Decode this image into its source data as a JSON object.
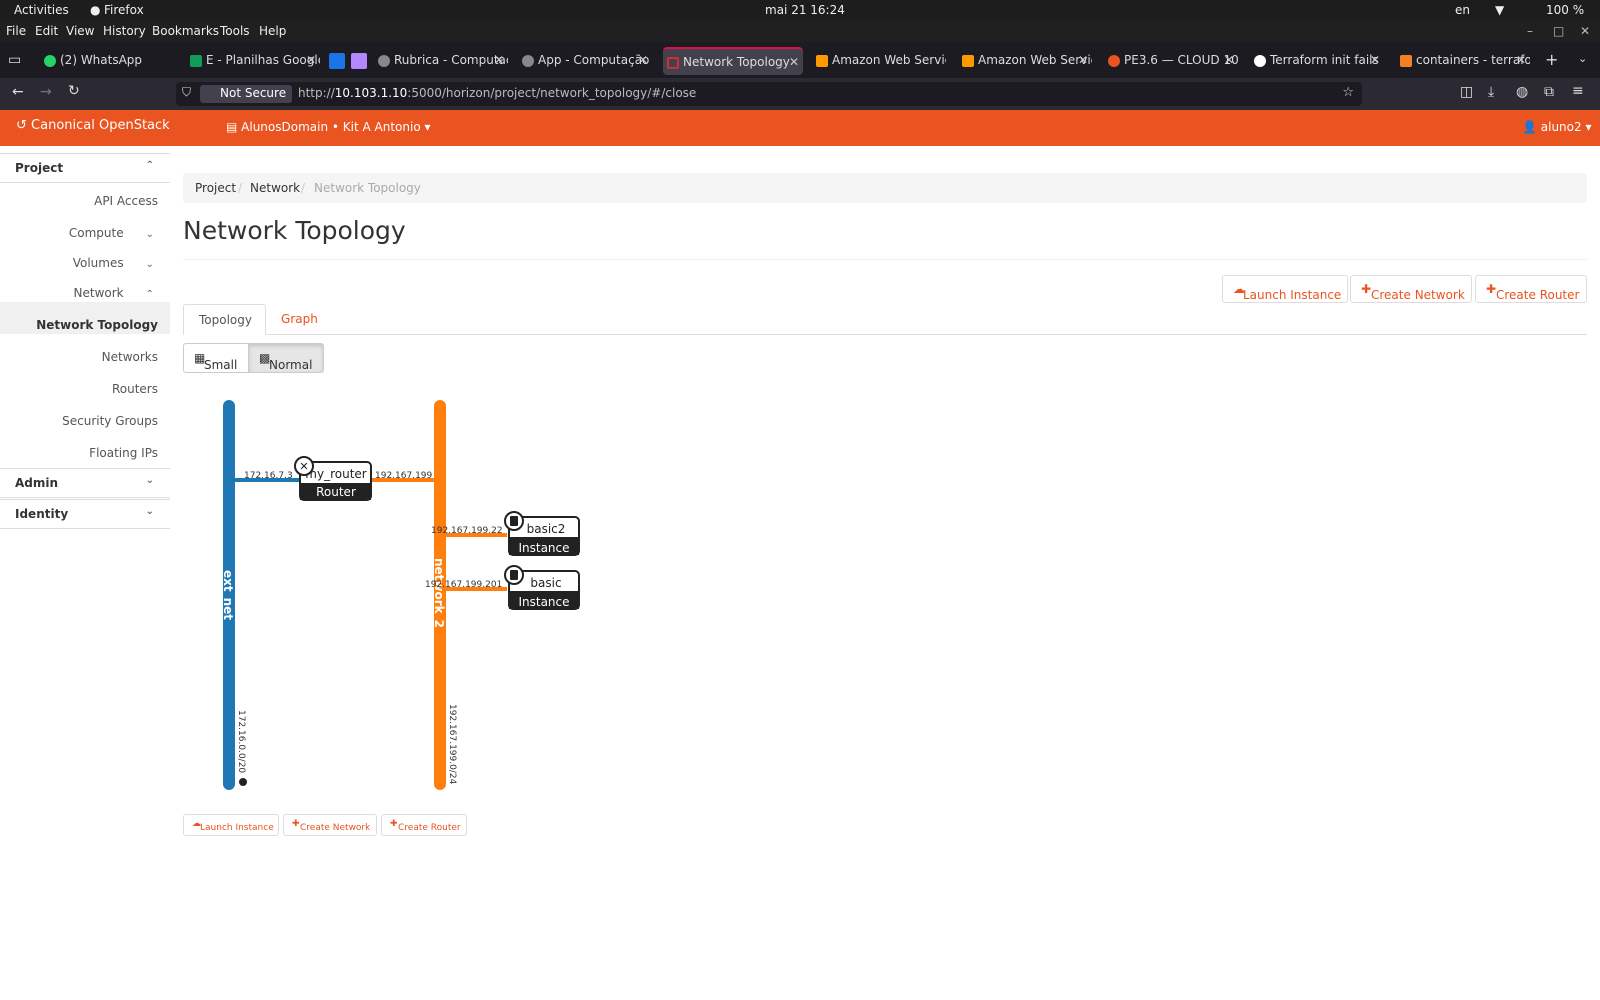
{
  "system": {
    "activities": "Activities",
    "app": "Firefox",
    "clock": "mai 21  16:24",
    "lang": "en",
    "battery": "100 %"
  },
  "menu": [
    "File",
    "Edit",
    "View",
    "History",
    "Bookmarks",
    "Tools",
    "Help"
  ],
  "browser_tabs": [
    {
      "title": "(2) WhatsApp",
      "color": "#25d366"
    },
    {
      "title": "E - Planilhas Google",
      "color": "#0f9d58"
    },
    {
      "title": "",
      "color": "#1a73e8"
    },
    {
      "title": "",
      "color": "#b388ff"
    },
    {
      "title": "Rubrica - Computaç",
      "color": "#888888"
    },
    {
      "title": "App - Computação",
      "color": "#888888"
    },
    {
      "title": "Network Topology",
      "color": "#d32f2f"
    },
    {
      "title": "Amazon Web Servic",
      "color": "#ff9900"
    },
    {
      "title": "Amazon Web Servic",
      "color": "#ff9900"
    },
    {
      "title": "PE3.6 — CLOUD 10",
      "color": "#e95420"
    },
    {
      "title": "Terraform init fails",
      "color": "#ffffff"
    },
    {
      "title": "containers - terrafo",
      "color": "#f48024"
    }
  ],
  "address": {
    "security": "Not Secure",
    "url_prefix": "http://",
    "url_host": "10.103.1.10",
    "url_rest": ":5000/horizon/project/network_topology/#/close"
  },
  "header": {
    "brand": "Canonical OpenStack",
    "project": "AlunosDomain • Kit A Antonio",
    "user": "aluno2"
  },
  "sidebar": {
    "project": "Project",
    "api_access": "API Access",
    "compute": "Compute",
    "volumes": "Volumes",
    "network": "Network",
    "network_topology": "Network Topology",
    "networks": "Networks",
    "routers": "Routers",
    "security_groups": "Security Groups",
    "floating_ips": "Floating IPs",
    "admin": "Admin",
    "identity": "Identity"
  },
  "breadcrumb": {
    "project": "Project",
    "network": "Network",
    "current": "Network Topology"
  },
  "page_title": "Network Topology",
  "actions": {
    "launch": "Launch Instance",
    "create_network": "Create Network",
    "create_router": "Create Router"
  },
  "tabs": {
    "topology": "Topology",
    "graph": "Graph"
  },
  "view_toggle": {
    "small": "Small",
    "normal": "Normal"
  },
  "colors": {
    "accent": "#e95420",
    "ext_net": "#1f77b4",
    "network2": "#ff7f0e"
  },
  "topology": {
    "networks": [
      {
        "name": "ext_net",
        "cidr": "172.16.0.0/20"
      },
      {
        "name": "network_2",
        "cidr": "192.167.199.0/24"
      }
    ],
    "router": {
      "name": "my_router",
      "type": "Router",
      "ip_ext": "172.16.7.3",
      "ip_int": "192.167.199"
    },
    "instances": [
      {
        "name": "basic2",
        "type": "Instance",
        "ip": "192.167.199.22"
      },
      {
        "name": "basic",
        "type": "Instance",
        "ip": "192.167.199.201"
      }
    ]
  }
}
